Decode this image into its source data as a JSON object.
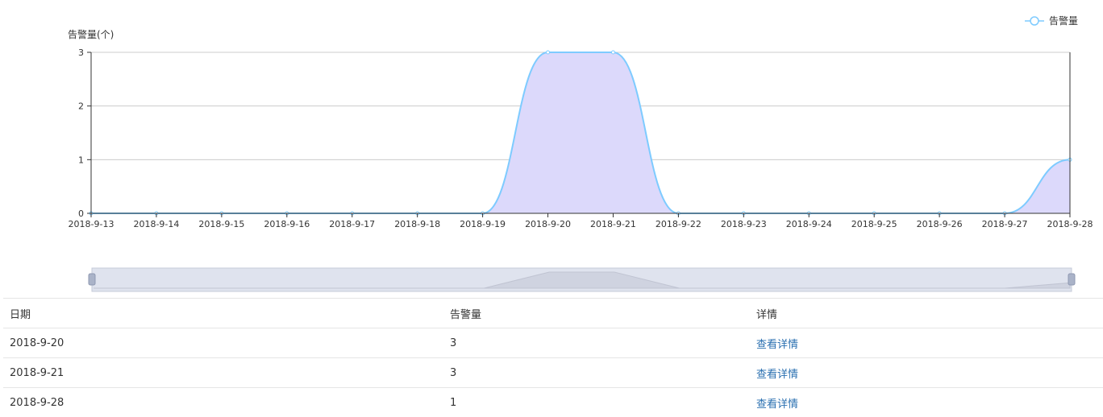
{
  "chart_data": {
    "type": "area",
    "ylabel": "告警量(个)",
    "x": [
      "2018-9-13",
      "2018-9-14",
      "2018-9-15",
      "2018-9-16",
      "2018-9-17",
      "2018-9-18",
      "2018-9-19",
      "2018-9-20",
      "2018-9-21",
      "2018-9-22",
      "2018-9-23",
      "2018-9-24",
      "2018-9-25",
      "2018-9-26",
      "2018-9-27",
      "2018-9-28"
    ],
    "series": [
      {
        "name": "告警量",
        "values": [
          0,
          0,
          0,
          0,
          0,
          0,
          0,
          3,
          3,
          0,
          0,
          0,
          0,
          0,
          0,
          1
        ]
      }
    ],
    "yticks": [
      "0",
      "1",
      "2",
      "3"
    ],
    "ylim": [
      0,
      3
    ],
    "grid": true,
    "legend": "top-right",
    "colors": {
      "line": "#7ecbff",
      "fill": "#dcd9fb",
      "axis": "#333333",
      "grid": "#cccccc"
    }
  },
  "table": {
    "headers": [
      "日期",
      "告警量",
      "详情"
    ],
    "rows": [
      {
        "date": "2018-9-20",
        "count": "3",
        "link": "查看详情"
      },
      {
        "date": "2018-9-21",
        "count": "3",
        "link": "查看详情"
      },
      {
        "date": "2018-9-28",
        "count": "1",
        "link": "查看详情"
      }
    ]
  }
}
